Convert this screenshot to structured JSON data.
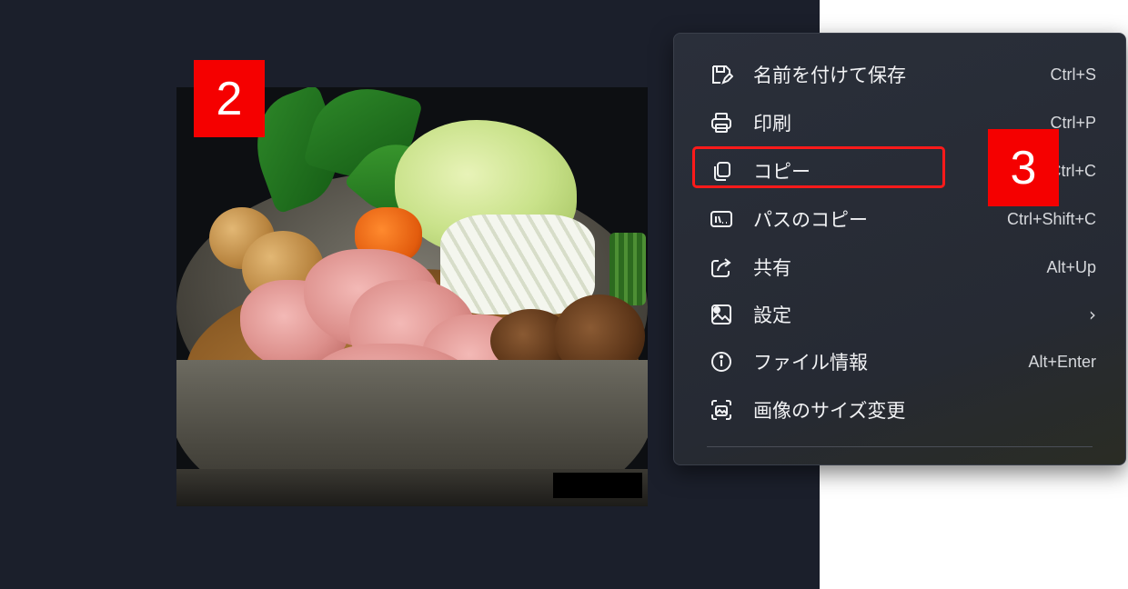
{
  "badges": {
    "step_2": "2",
    "step_3": "3"
  },
  "menu": {
    "items": [
      {
        "label": "名前を付けて保存",
        "shortcut": "Ctrl+S",
        "icon": "save-as-icon"
      },
      {
        "label": "印刷",
        "shortcut": "Ctrl+P",
        "icon": "print-icon"
      },
      {
        "label": "コピー",
        "shortcut": "Ctrl+C",
        "icon": "copy-icon"
      },
      {
        "label": "パスのコピー",
        "shortcut": "Ctrl+Shift+C",
        "icon": "copy-path-icon"
      },
      {
        "label": "共有",
        "shortcut": "Alt+Up",
        "icon": "share-icon"
      },
      {
        "label": "設定",
        "shortcut": "",
        "icon": "set-as-icon",
        "has_submenu": true
      },
      {
        "label": "ファイル情報",
        "shortcut": "Alt+Enter",
        "icon": "info-icon"
      },
      {
        "label": "画像のサイズ変更",
        "shortcut": "",
        "icon": "resize-image-icon"
      }
    ],
    "submenu_chevron": "›",
    "highlighted_item": "コピー"
  },
  "colors": {
    "viewer_background": "#1b1f2b",
    "menu_background": "#262a33",
    "badge_red": "#f50000",
    "highlight_red": "#ff1a1a",
    "menu_text": "#f1f2f4"
  }
}
